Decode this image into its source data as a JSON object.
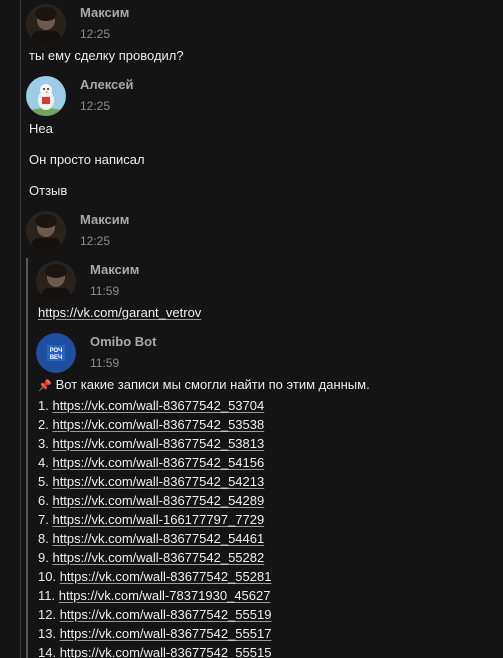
{
  "messages": [
    {
      "author": "Максим",
      "time": "12:25",
      "text": "ты ему сделку проводил?"
    },
    {
      "author": "Алексей",
      "time": "12:25",
      "lines": [
        "Неа",
        "Он просто написал",
        "Отзыв"
      ]
    },
    {
      "author": "Максим",
      "time": "12:25"
    }
  ],
  "quoted": {
    "author": "Максим",
    "time": "11:59",
    "link": "https://vk.com/garant_vetrov"
  },
  "bot": {
    "author": "Omibo Bot",
    "time": "11:59",
    "avatar_text": "РОЧ ВЕЧ",
    "intro_icon": "pin-icon",
    "intro": "Вот какие записи мы смогли найти по этим данным.",
    "results": [
      {
        "num": "1.",
        "url": "https://vk.com/wall-83677542_53704"
      },
      {
        "num": "2.",
        "url": "https://vk.com/wall-83677542_53538"
      },
      {
        "num": "3.",
        "url": "https://vk.com/wall-83677542_53813"
      },
      {
        "num": "4.",
        "url": "https://vk.com/wall-83677542_54156"
      },
      {
        "num": "5.",
        "url": "https://vk.com/wall-83677542_54213"
      },
      {
        "num": "6.",
        "url": "https://vk.com/wall-83677542_54289"
      },
      {
        "num": "7.",
        "url": "https://vk.com/wall-166177797_7729"
      },
      {
        "num": "8.",
        "url": "https://vk.com/wall-83677542_54461"
      },
      {
        "num": "9.",
        "url": "https://vk.com/wall-83677542_55282"
      },
      {
        "num": "10.",
        "url": "https://vk.com/wall-83677542_55281"
      },
      {
        "num": "11.",
        "url": "https://vk.com/wall-78371930_45627"
      },
      {
        "num": "12.",
        "url": "https://vk.com/wall-83677542_55519"
      },
      {
        "num": "13.",
        "url": "https://vk.com/wall-83677542_55517"
      },
      {
        "num": "14.",
        "url": "https://vk.com/wall-83677542_55515"
      }
    ]
  }
}
